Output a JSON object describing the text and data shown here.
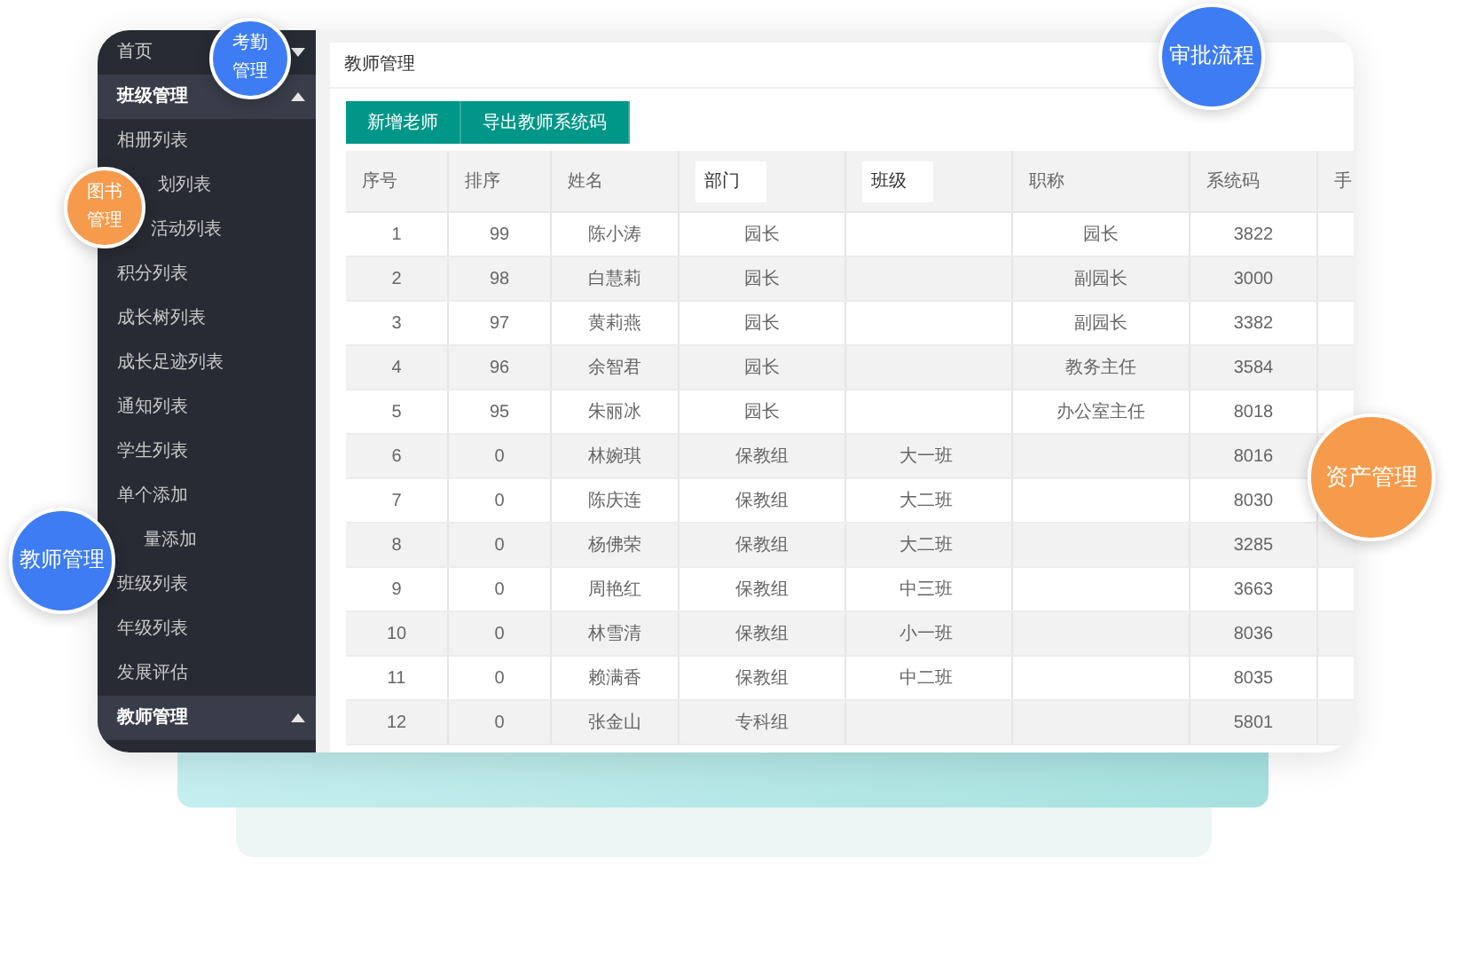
{
  "sidebar": {
    "groups": [
      {
        "label": "首页",
        "expanded": false
      },
      {
        "label": "班级管理",
        "expanded": true,
        "children": [
          "相册列表",
          "划列表",
          "活动列表",
          "积分列表",
          "成长树列表",
          "成长足迹列表",
          "通知列表",
          "学生列表",
          "单个添加",
          "量添加",
          "班级列表",
          "年级列表",
          "发展评估"
        ]
      },
      {
        "label": "教师管理",
        "expanded": true
      }
    ]
  },
  "breadcrumb": "教师管理",
  "buttons": [
    "新增老师",
    "导出教师系统码"
  ],
  "table": {
    "columns": [
      {
        "label": "序号",
        "kind": "text"
      },
      {
        "label": "排序",
        "kind": "text"
      },
      {
        "label": "姓名",
        "kind": "text"
      },
      {
        "label": "部门",
        "kind": "filter"
      },
      {
        "label": "班级",
        "kind": "filter"
      },
      {
        "label": "职称",
        "kind": "text"
      },
      {
        "label": "系统码",
        "kind": "text"
      },
      {
        "label": "手",
        "kind": "text"
      }
    ],
    "rows": [
      [
        "1",
        "99",
        "陈小涛",
        "园长",
        "",
        "园长",
        "3822"
      ],
      [
        "2",
        "98",
        "白慧莉",
        "园长",
        "",
        "副园长",
        "3000"
      ],
      [
        "3",
        "97",
        "黄莉燕",
        "园长",
        "",
        "副园长",
        "3382"
      ],
      [
        "4",
        "96",
        "余智君",
        "园长",
        "",
        "教务主任",
        "3584"
      ],
      [
        "5",
        "95",
        "朱丽冰",
        "园长",
        "",
        "办公室主任",
        "8018"
      ],
      [
        "6",
        "0",
        "林婉琪",
        "保教组",
        "大一班",
        "",
        "8016"
      ],
      [
        "7",
        "0",
        "陈庆连",
        "保教组",
        "大二班",
        "",
        "8030"
      ],
      [
        "8",
        "0",
        "杨佛荣",
        "保教组",
        "大二班",
        "",
        "3285"
      ],
      [
        "9",
        "0",
        "周艳红",
        "保教组",
        "中三班",
        "",
        "3663"
      ],
      [
        "10",
        "0",
        "林雪清",
        "保教组",
        "小一班",
        "",
        "8036"
      ],
      [
        "11",
        "0",
        "赖满香",
        "保教组",
        "中二班",
        "",
        "8035"
      ],
      [
        "12",
        "0",
        "张金山",
        "专科组",
        "",
        "",
        "5801"
      ]
    ]
  },
  "bubbles": [
    {
      "label": "考勤管理",
      "color": "#3d7cf2"
    },
    {
      "label": "图书管理",
      "color": "#f59b4b"
    },
    {
      "label": "教师管理",
      "color": "#3d7cf2"
    },
    {
      "label": "审批流程",
      "color": "#3d7cf2"
    },
    {
      "label": "资产管理",
      "color": "#f59b4b"
    }
  ]
}
